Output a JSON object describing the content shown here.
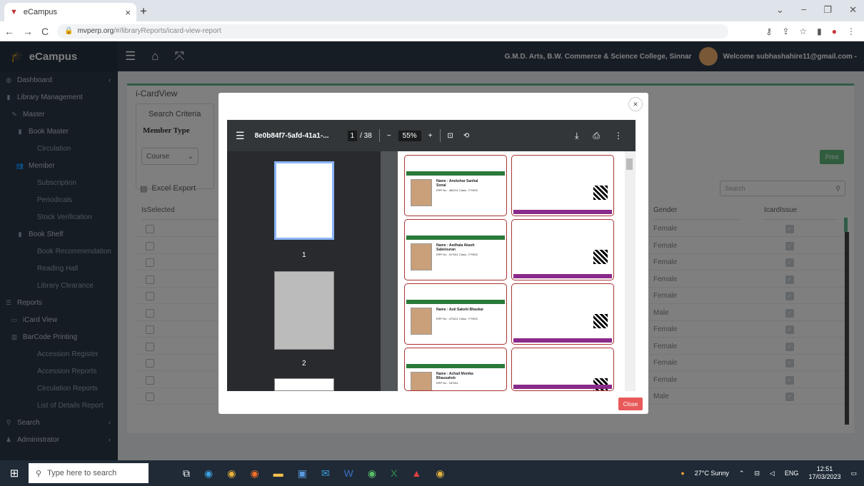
{
  "browser": {
    "tab_title": "eCampus",
    "url_domain": "mvperp.org",
    "url_path": "/#/libraryReports/icard-view-report"
  },
  "app": {
    "brand": "eCampus",
    "college": "G.M.D. Arts, B.W. Commerce & Science College, Sinnar",
    "welcome": "Welcome subhashahire11@gmail.com -"
  },
  "sidebar": {
    "items": [
      {
        "label": "Dashboard",
        "icon": "dashboard-icon",
        "level": 0,
        "arrow": "‹"
      },
      {
        "label": "Library Management",
        "icon": "book-icon",
        "level": 0,
        "arrow": ""
      },
      {
        "label": "Master",
        "icon": "pencil-icon",
        "level": 1,
        "arrow": ""
      },
      {
        "label": "Book Master",
        "icon": "book-icon",
        "level": 2,
        "arrow": ""
      },
      {
        "label": "Circulation",
        "icon": "",
        "level": 3,
        "arrow": ""
      },
      {
        "label": "Member",
        "icon": "users-icon",
        "level": 2,
        "arrow": ""
      },
      {
        "label": "Subscription",
        "icon": "",
        "level": 3,
        "arrow": ""
      },
      {
        "label": "Periodicals",
        "icon": "",
        "level": 3,
        "arrow": ""
      },
      {
        "label": "Stock Verification",
        "icon": "",
        "level": 3,
        "arrow": ""
      },
      {
        "label": "Book Shelf",
        "icon": "book-icon",
        "level": 2,
        "arrow": ""
      },
      {
        "label": "Book Recommendation",
        "icon": "",
        "level": 3,
        "arrow": ""
      },
      {
        "label": "Reading Hall",
        "icon": "",
        "level": 3,
        "arrow": ""
      },
      {
        "label": "Library Clearance",
        "icon": "",
        "level": 3,
        "arrow": ""
      },
      {
        "label": "Reports",
        "icon": "list-icon",
        "level": 0,
        "arrow": ""
      },
      {
        "label": "iCard View",
        "icon": "card-icon",
        "level": 1,
        "arrow": ""
      },
      {
        "label": "BarCode Printing",
        "icon": "barcode-icon",
        "level": 1,
        "arrow": ""
      },
      {
        "label": "Accession Register",
        "icon": "",
        "level": 3,
        "arrow": ""
      },
      {
        "label": "Accession Reports",
        "icon": "",
        "level": 3,
        "arrow": ""
      },
      {
        "label": "Circulation Reports",
        "icon": "",
        "level": 3,
        "arrow": ""
      },
      {
        "label": "List of Details Report",
        "icon": "",
        "level": 3,
        "arrow": ""
      },
      {
        "label": "Search",
        "icon": "search-icon",
        "level": 0,
        "arrow": "‹"
      },
      {
        "label": "Administrator",
        "icon": "user-icon",
        "level": 0,
        "arrow": "‹"
      }
    ]
  },
  "page": {
    "title": "i-CardView",
    "search_criteria": "Search Criteria",
    "member_type_label": "Member Type",
    "member_type_value": "Course",
    "excel_export": "Excel Export",
    "print_label": "Print",
    "search_placeholder": "Search",
    "columns": [
      "IsSelected",
      "Gender",
      "IcardIssue"
    ],
    "rows": [
      {
        "gender": "Female"
      },
      {
        "gender": "Female"
      },
      {
        "gender": "Female"
      },
      {
        "gender": "Female"
      },
      {
        "gender": "Female"
      },
      {
        "gender": "Male"
      },
      {
        "gender": "Female"
      },
      {
        "gender": "Female"
      },
      {
        "gender": "Female"
      },
      {
        "gender": "Female"
      },
      {
        "gender": "Male"
      }
    ]
  },
  "modal": {
    "close_label": "Close",
    "pdf": {
      "filename": "8e0b84f7-5afd-41a1-...",
      "page": "1",
      "total": "/ 38",
      "zoom": "55%",
      "thumb_labels": [
        "1",
        "2"
      ]
    },
    "cards": [
      {
        "name": "Name : Anekshar Sanhal Sonal",
        "info": "ERP No : 484211 Class : FYBSC"
      },
      {
        "name": "Name : Aedhala Akash Sabelsuran",
        "info": "ERP No : 417811 Class : FYBSC"
      },
      {
        "name": "Name : Auti Sakshi Bhaskar",
        "info": "ERP No : 473411 Class : FYBSC"
      },
      {
        "name": "Name : Achad Monika Bhausaheb",
        "info": "ERP No : 187811"
      }
    ]
  },
  "taskbar": {
    "search_placeholder": "Type here to search",
    "weather": "27°C Sunny",
    "lang": "ENG",
    "time": "12:51",
    "date": "17/03/2023"
  }
}
